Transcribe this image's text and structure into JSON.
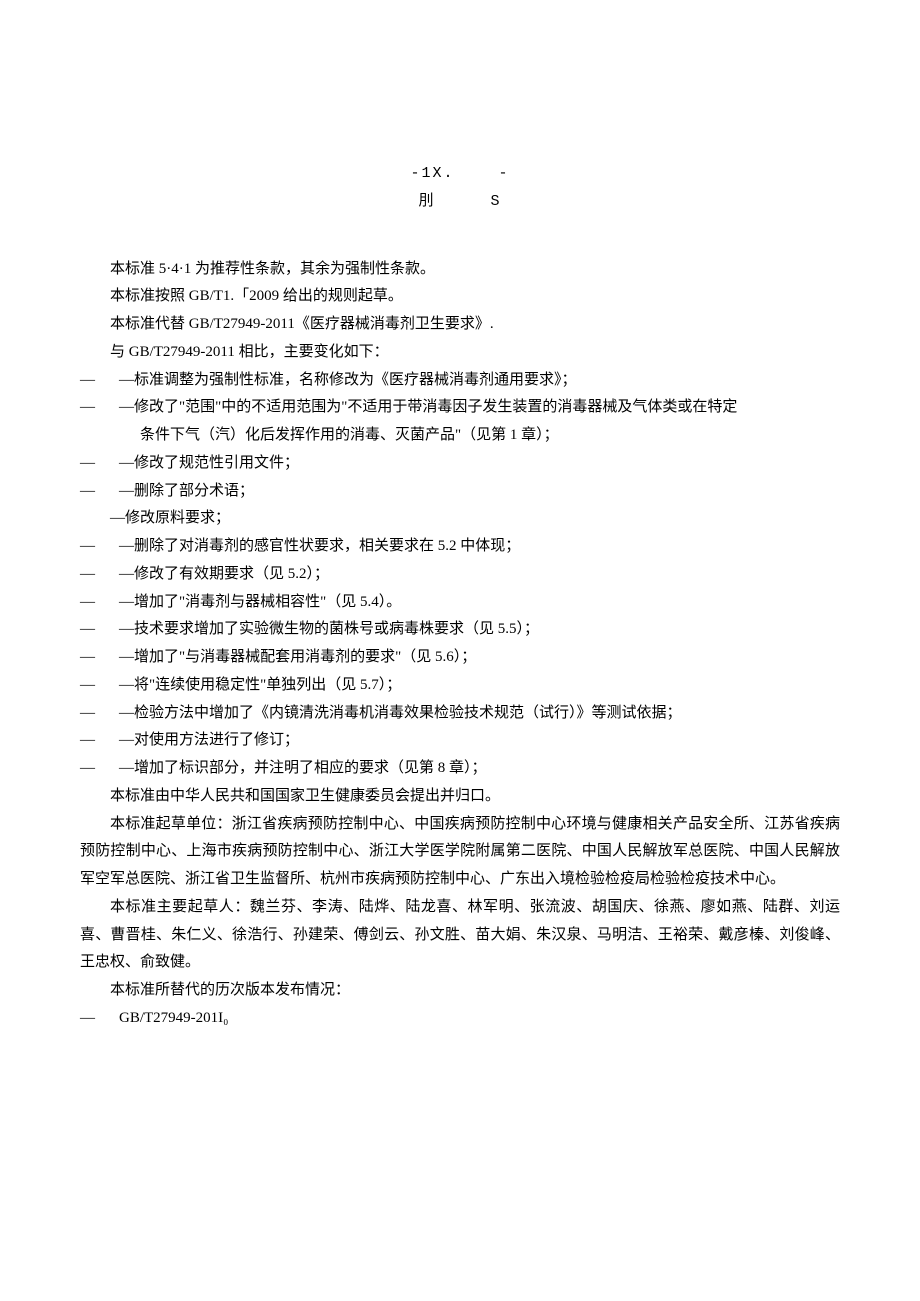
{
  "header": {
    "line1": "-1X.    -",
    "line2": "刖     S"
  },
  "body": {
    "p1": "本标准 5·4·1 为推荐性条款，其余为强制性条款。",
    "p2": "本标准按照 GB/T1.「2009 给出的规则起草。",
    "p3": "本标准代替 GB/T27949-2011《医疗器械消毒剂卫生要求》.",
    "p4": "与 GB/T27949-2011 相比，主要变化如下：",
    "li1": "—标准调整为强制性标准，名称修改为《医疗器械消毒剂通用要求》；",
    "li2a": "—修改了\"范围\"中的不适用范围为\"不适用于带消毒因子发生装置的消毒器械及气体类或在特定",
    "li2b": "条件下气（汽）化后发挥作用的消毒、灭菌产品\"（见第 1 章）；",
    "li3": "—修改了规范性引用文件；",
    "li4": "—删除了部分术语；",
    "li5": "—修改原料要求；",
    "li6": "—删除了对消毒剂的感官性状要求，相关要求在 5.2 中体现；",
    "li7": "—修改了有效期要求（见 5.2）；",
    "li8": "—增加了\"消毒剂与器械相容性\"（见 5.4）。",
    "li9": "—技术要求增加了实验微生物的菌株号或病毒株要求（见 5.5）；",
    "li10": "—增加了\"与消毒器械配套用消毒剂的要求\"（见 5.6）；",
    "li11": "—将\"连续使用稳定性\"单独列出（见 5.7）；",
    "li12": "—检验方法中增加了《内镜清洗消毒机消毒效果检验技术规范（试行）》等测试依据；",
    "li13": "—对使用方法进行了修订；",
    "li14": "—增加了标识部分，并注明了相应的要求（见第 8 章）；",
    "p5": "本标准由中华人民共和国国家卫生健康委员会提出并归口。",
    "p6": "本标准起草单位：浙江省疾病预防控制中心、中国疾病预防控制中心环境与健康相关产品安全所、江苏省疾病预防控制中心、上海市疾病预防控制中心、浙江大学医学院附属第二医院、中国人民解放军总医院、中国人民解放军空军总医院、浙江省卫生监督所、杭州市疾病预防控制中心、广东出入境检验检疫局检验检疫技术中心。",
    "p7": "本标准主要起草人：魏兰芬、李涛、陆烨、陆龙喜、林军明、张流波、胡国庆、徐燕、廖如燕、陆群、刘运喜、曹晋桂、朱仁义、徐浩行、孙建荣、傅剑云、孙文胜、苗大娟、朱汉泉、马明洁、王裕荣、戴彦榛、刘俊峰、王忠权、俞致健。",
    "p8": "本标准所替代的历次版本发布情况：",
    "li15": "GB/T27949-201I₀"
  },
  "dash": "—"
}
